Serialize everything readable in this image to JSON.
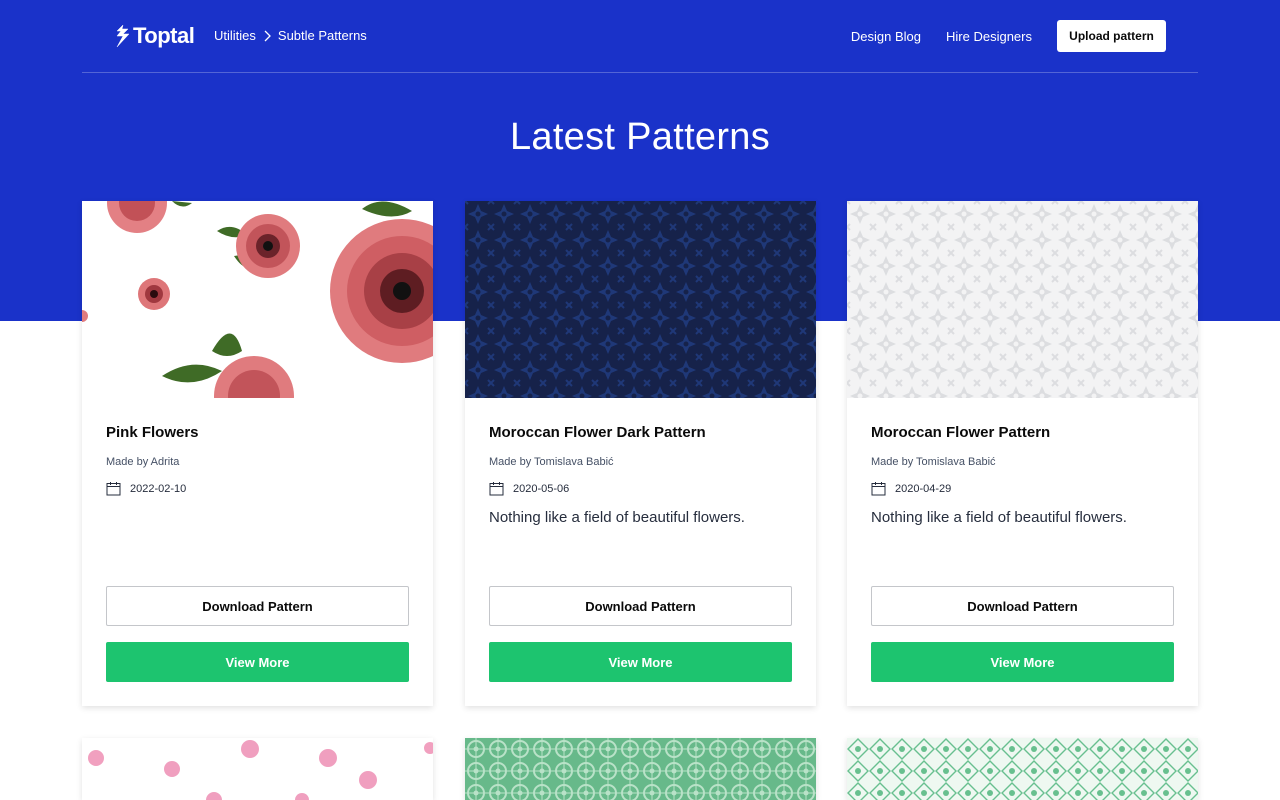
{
  "header": {
    "logo_text": "Toptal",
    "breadcrumb": [
      "Utilities",
      "Subtle Patterns"
    ],
    "nav": {
      "design_blog": "Design Blog",
      "hire_designers": "Hire Designers",
      "upload": "Upload pattern"
    }
  },
  "main": {
    "title": "Latest Patterns",
    "cards": [
      {
        "title": "Pink Flowers",
        "author": "Made by Adrita",
        "date": "2022-02-10",
        "description": "",
        "download": "Download Pattern",
        "view": "View More"
      },
      {
        "title": "Moroccan Flower Dark Pattern",
        "author": "Made by Tomislava Babić",
        "date": "2020-05-06",
        "description": "Nothing like a field of beautiful flowers.",
        "download": "Download Pattern",
        "view": "View More"
      },
      {
        "title": "Moroccan Flower Pattern",
        "author": "Made by Tomislava Babić",
        "date": "2020-04-29",
        "description": "Nothing like a field of beautiful flowers.",
        "download": "Download Pattern",
        "view": "View More"
      }
    ]
  },
  "colors": {
    "brand_blue": "#1a32c9",
    "accent_green": "#1dc46f"
  },
  "icons": [
    "toptal-logo-icon",
    "chevron-right-icon",
    "calendar-icon"
  ]
}
